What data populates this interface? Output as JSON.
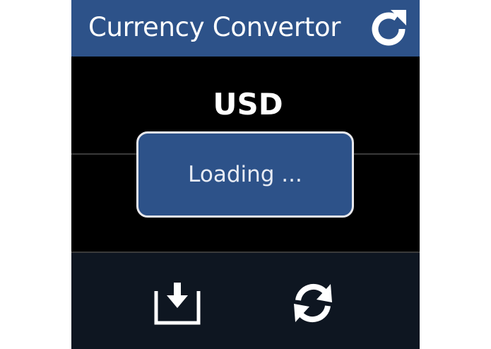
{
  "header": {
    "title": "Currency Convertor",
    "refresh_icon": "refresh-icon"
  },
  "main": {
    "currency_code": "USD"
  },
  "loading_dialog": {
    "text": "Loading ..."
  },
  "bottom_bar": {
    "download_icon": "download-icon",
    "sync_icon": "sync-icon"
  },
  "colors": {
    "header_bg": "#2d5289",
    "screen_bg": "#000000",
    "bottom_bar_bg": "#0e1621",
    "text": "#ffffff"
  }
}
